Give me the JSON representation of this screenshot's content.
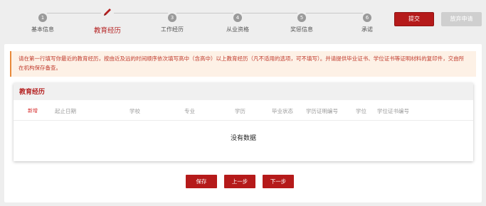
{
  "steps": [
    {
      "num": "1",
      "label": "基本信息"
    },
    {
      "num": "",
      "label": "教育经历"
    },
    {
      "num": "3",
      "label": "工作经历"
    },
    {
      "num": "4",
      "label": "从业资格"
    },
    {
      "num": "5",
      "label": "奖惩信息"
    },
    {
      "num": "6",
      "label": "承诺"
    }
  ],
  "header": {
    "submit_label": "提交",
    "discard_label": "放弃申请"
  },
  "notice": "请在第一行填写你最近的教育经历，按由近及远的时间顺序依次填写高中（含高中）以上教育经历（凡不适用的选项，可不填写）。并请提供毕业证书、学位证书等证明材料的复印件，交由所在机构保存备查。",
  "education": {
    "title": "教育经历",
    "add_label": "新增",
    "columns": [
      "起止日期",
      "学校",
      "专业",
      "学历",
      "毕业状态",
      "学历证明编号",
      "学位",
      "学位证书编号"
    ],
    "empty_text": "没有数据"
  },
  "actions": {
    "save": "保存",
    "prev": "上一步",
    "next": "下一步"
  },
  "colors": {
    "accent": "#b51a1a",
    "notice_bg": "#fdf1e6",
    "notice_border": "#e8893a"
  }
}
